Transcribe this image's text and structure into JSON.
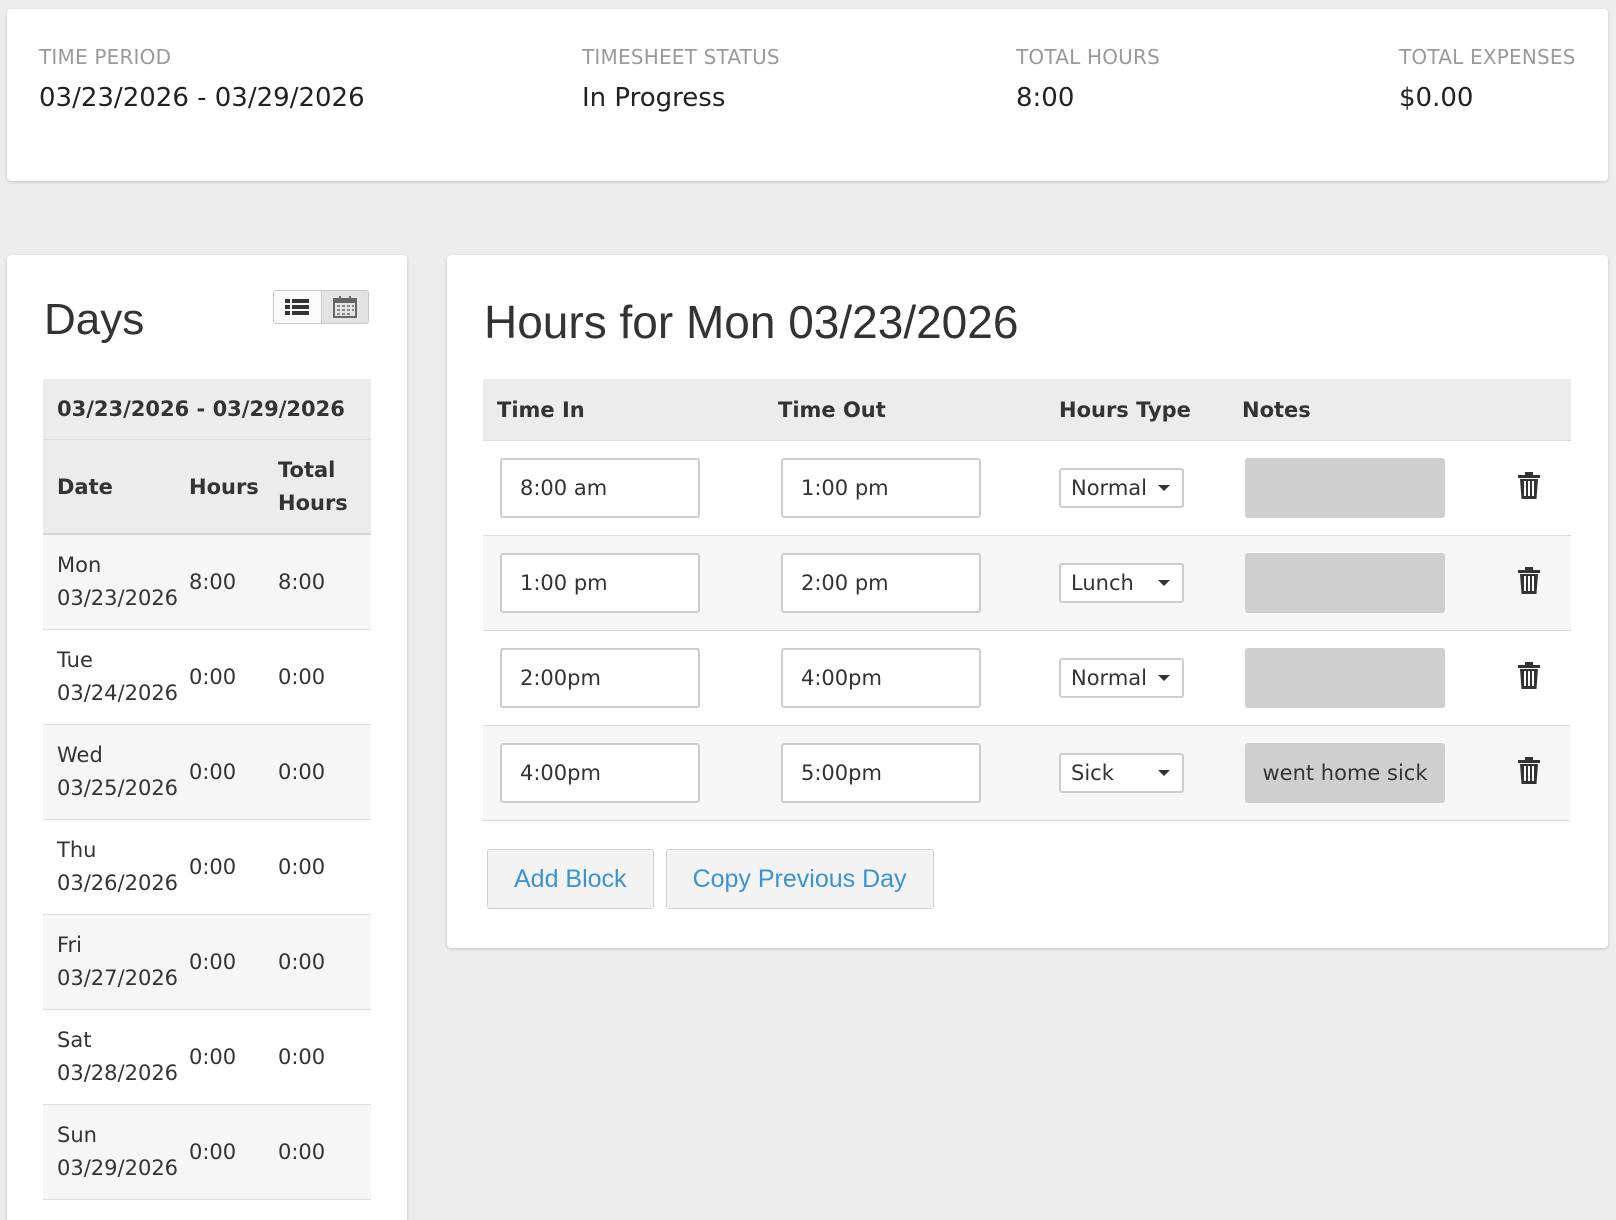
{
  "summary": {
    "time_period": {
      "label": "TIME PERIOD",
      "value": "03/23/2026 - 03/29/2026"
    },
    "status": {
      "label": "TIMESHEET STATUS",
      "value": "In Progress"
    },
    "total_hours": {
      "label": "TOTAL HOURS",
      "value": "8:00"
    },
    "total_expenses": {
      "label": "TOTAL EXPENSES",
      "value": "$0.00"
    }
  },
  "days": {
    "title": "Days",
    "view_toggle": {
      "list_icon": "list-icon",
      "calendar_icon": "calendar-icon",
      "active": "list"
    },
    "range": "03/23/2026 - 03/29/2026",
    "headers": {
      "date": "Date",
      "hours": "Hours",
      "total_line1": "Total",
      "total_line2": "Hours"
    },
    "rows": [
      {
        "day": "Mon",
        "date": "03/23/2026",
        "hours": "8:00",
        "total": "8:00"
      },
      {
        "day": "Tue",
        "date": "03/24/2026",
        "hours": "0:00",
        "total": "0:00"
      },
      {
        "day": "Wed",
        "date": "03/25/2026",
        "hours": "0:00",
        "total": "0:00"
      },
      {
        "day": "Thu",
        "date": "03/26/2026",
        "hours": "0:00",
        "total": "0:00"
      },
      {
        "day": "Fri",
        "date": "03/27/2026",
        "hours": "0:00",
        "total": "0:00"
      },
      {
        "day": "Sat",
        "date": "03/28/2026",
        "hours": "0:00",
        "total": "0:00"
      },
      {
        "day": "Sun",
        "date": "03/29/2026",
        "hours": "0:00",
        "total": "0:00"
      }
    ]
  },
  "hours": {
    "title": "Hours for Mon 03/23/2026",
    "headers": {
      "time_in": "Time In",
      "time_out": "Time Out",
      "hours_type": "Hours Type",
      "notes": "Notes"
    },
    "blocks": [
      {
        "time_in": "8:00 am",
        "time_out": "1:00 pm",
        "type": "Normal",
        "notes": ""
      },
      {
        "time_in": "1:00 pm",
        "time_out": "2:00 pm",
        "type": "Lunch",
        "notes": ""
      },
      {
        "time_in": "2:00pm",
        "time_out": "4:00pm",
        "type": "Normal",
        "notes": ""
      },
      {
        "time_in": "4:00pm",
        "time_out": "5:00pm",
        "type": "Sick",
        "notes": "went home sick"
      }
    ],
    "add_block_label": "Add Block",
    "copy_previous_label": "Copy Previous Day"
  },
  "colors": {
    "link_blue": "#3a93d6",
    "note_gray": "#cfcfcf",
    "header_gray": "#ececec",
    "page_bg": "#ededed"
  }
}
